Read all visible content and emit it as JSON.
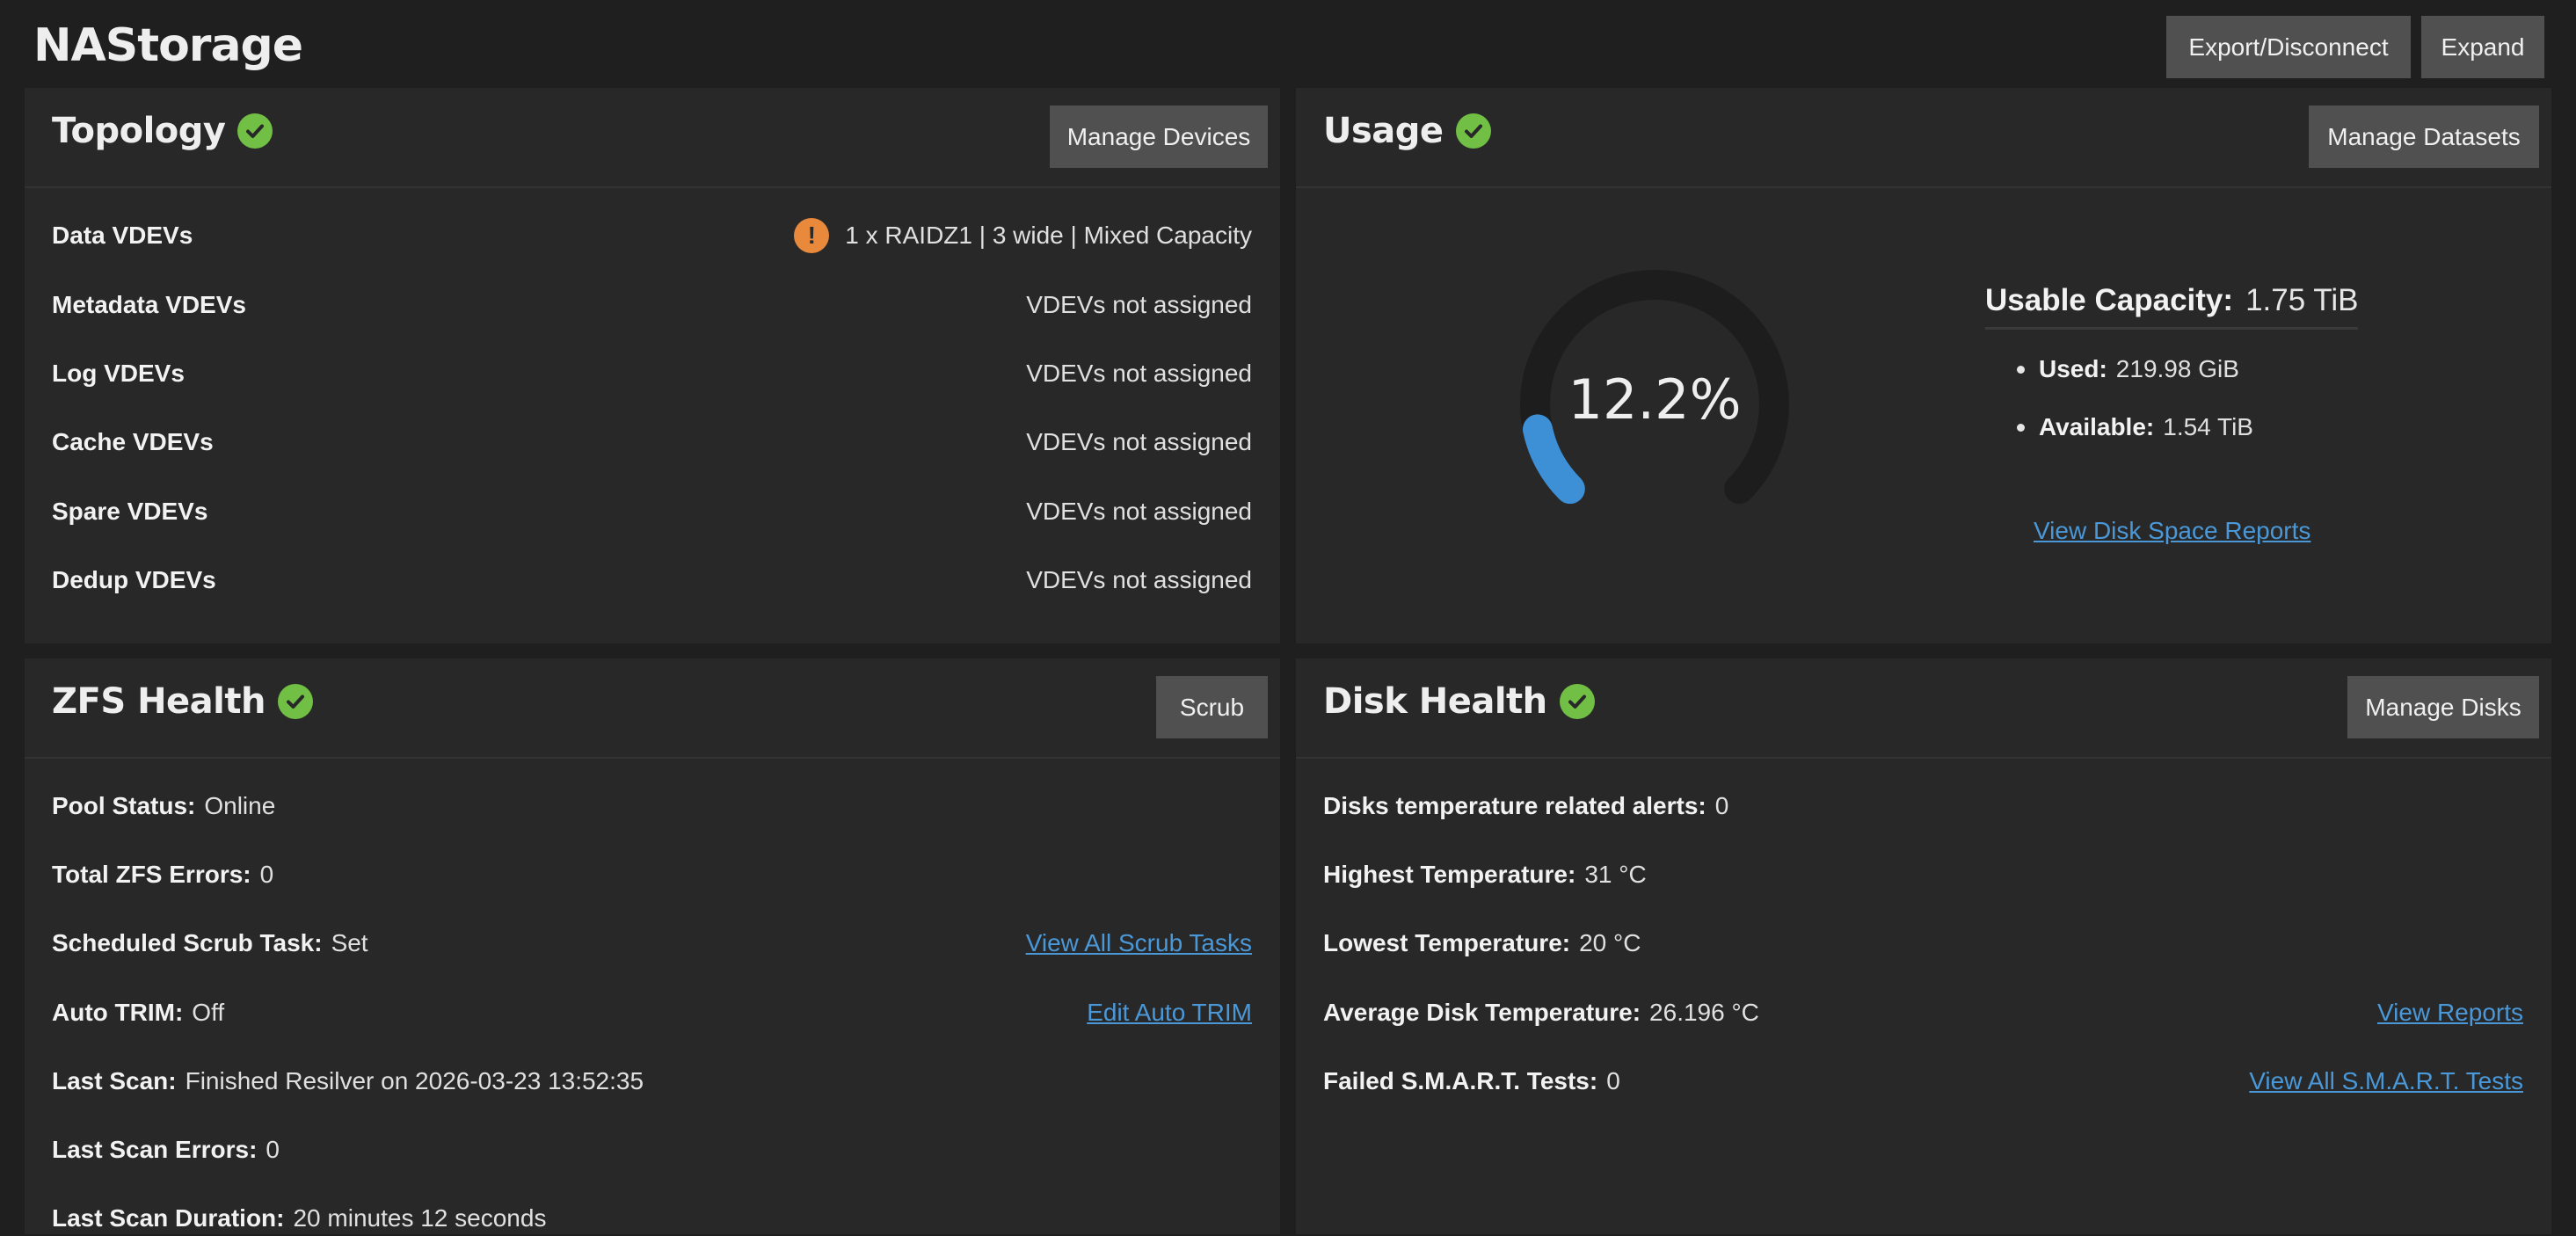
{
  "pool": {
    "name": "NAStorage",
    "export_label": "Export/Disconnect",
    "expand_label": "Expand"
  },
  "topology": {
    "title": "Topology",
    "button": "Manage Devices",
    "rows": [
      {
        "label": "Data VDEVs",
        "value": "1 x RAIDZ1 | 3 wide | Mixed Capacity"
      },
      {
        "label": "Metadata VDEVs",
        "value": "VDEVs not assigned"
      },
      {
        "label": "Log VDEVs",
        "value": "VDEVs not assigned"
      },
      {
        "label": "Cache VDEVs",
        "value": "VDEVs not assigned"
      },
      {
        "label": "Spare VDEVs",
        "value": "VDEVs not assigned"
      },
      {
        "label": "Dedup VDEVs",
        "value": "VDEVs not assigned"
      }
    ]
  },
  "usage": {
    "title": "Usage",
    "button": "Manage Datasets",
    "percent_label": "12.2%",
    "percent": 12.2,
    "capacity_label": "Usable Capacity:",
    "capacity_value": "1.75 TiB",
    "used_label": "Used:",
    "used_value": "219.98 GiB",
    "available_label": "Available:",
    "available_value": "1.54 TiB",
    "report_link": "View Disk Space Reports"
  },
  "zfs_health": {
    "title": "ZFS Health",
    "button": "Scrub",
    "pool_status_label": "Pool Status:",
    "pool_status_value": "Online",
    "errors_label": "Total ZFS Errors:",
    "errors_value": "0",
    "scrub_task_label": "Scheduled Scrub Task:",
    "scrub_task_value": "Set",
    "scrub_task_link": "View All Scrub Tasks",
    "autotrim_label": "Auto TRIM:",
    "autotrim_value": "Off",
    "autotrim_link": "Edit Auto TRIM",
    "last_scan_label": "Last Scan:",
    "last_scan_value": "Finished Resilver on 2026-03-23 13:52:35",
    "last_scan_errors_label": "Last Scan Errors:",
    "last_scan_errors_value": "0",
    "last_scan_duration_label": "Last Scan Duration:",
    "last_scan_duration_value": "20 minutes 12 seconds"
  },
  "disk_health": {
    "title": "Disk Health",
    "button": "Manage Disks",
    "temp_alerts_label": "Disks temperature related alerts:",
    "temp_alerts_value": "0",
    "highest_label": "Highest Temperature:",
    "highest_value": "31 °C",
    "lowest_label": "Lowest Temperature:",
    "lowest_value": "20 °C",
    "average_label": "Average Disk Temperature:",
    "average_value": "26.196 °C",
    "reports_link": "View Reports",
    "smart_label": "Failed S.M.A.R.T. Tests:",
    "smart_value": "0",
    "smart_link": "View All S.M.A.R.T. Tests"
  },
  "colors": {
    "ok": "#71bf44",
    "warning": "#e8893c",
    "accent": "#4a98d8",
    "gauge_track": "#1e1e1e"
  },
  "icons": [
    "check-circle-icon",
    "warning-icon"
  ]
}
